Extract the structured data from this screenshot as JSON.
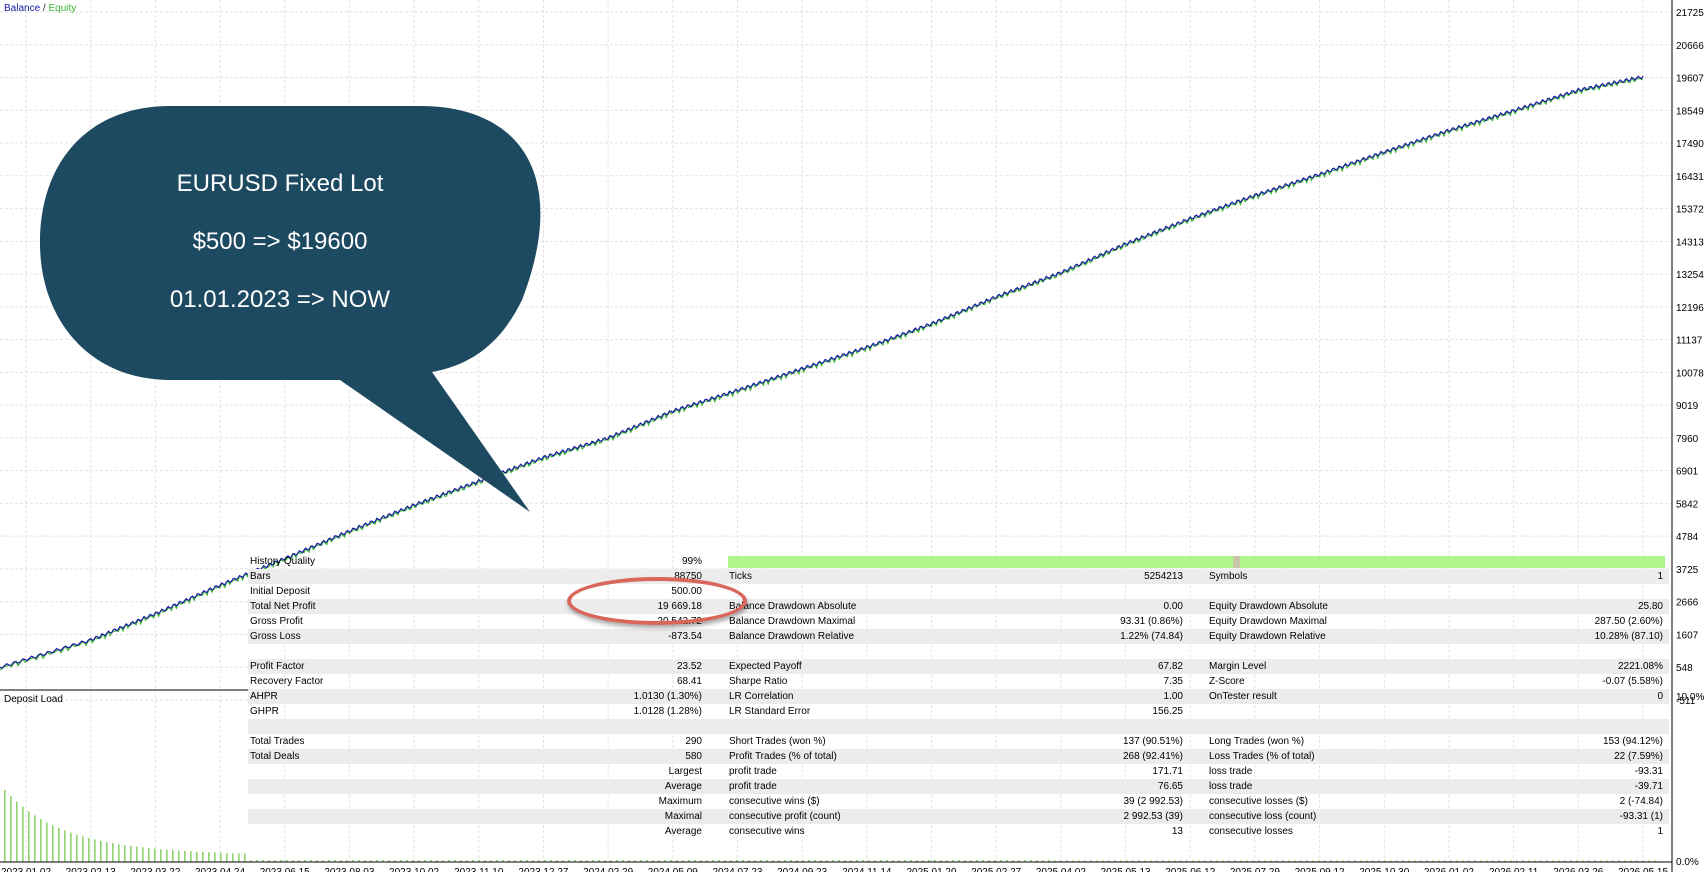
{
  "legend": {
    "balance": "Balance",
    "separator": "/",
    "equity": "Equity"
  },
  "colors": {
    "balance": "#1a1aa8",
    "equity": "#3cb531",
    "bubble": "#1d4a61",
    "oval": "#d8665a",
    "quality_bar": "#aef58c",
    "deposit_load": "#8fd36a"
  },
  "callout": {
    "line1": "EURUSD Fixed Lot",
    "line2": "$500 => $19600",
    "line3": "01.01.2023 => NOW"
  },
  "deposit_load_label": "Deposit Load",
  "deposit_load_axis": [
    "10.0%",
    "0.0%"
  ],
  "chart_data": {
    "type": "line",
    "series": [
      {
        "name": "Balance",
        "color": "#1a1aa8"
      },
      {
        "name": "Equity",
        "color": "#3cb531"
      }
    ],
    "x": [
      "2023.01.02",
      "2023.02.13",
      "2023.03.22",
      "2023.04.24",
      "2023.06.15",
      "2023.08.03",
      "2023.10.02",
      "2023.11.10",
      "2023.12.27",
      "2024.02.29",
      "2024.05.09",
      "2024.07.23",
      "2024.09.23",
      "2024.11.14",
      "2025.01.20",
      "2025.02.27",
      "2025.04.02",
      "2025.05.13",
      "2025.06.12",
      "2025.07.29",
      "2025.09.12",
      "2025.10.30",
      "2026.01.02",
      "2026.02.11",
      "2026.03.26",
      "2026.05.15"
    ],
    "balance_values": [
      548,
      1430,
      2280,
      3200,
      4060,
      4950,
      5790,
      6560,
      7330,
      7960,
      8830,
      9500,
      10200,
      10890,
      11650,
      12520,
      13300,
      14230,
      15050,
      15800,
      16480,
      17200,
      17900,
      18540,
      19200,
      19630
    ],
    "y_ticks": [
      21725,
      20666,
      19607,
      18549,
      17490,
      16431,
      15372,
      14313,
      13254,
      12196,
      11137,
      10078,
      9019,
      7960,
      6901,
      5842,
      4784,
      3725,
      2666,
      1607,
      548,
      -511
    ],
    "ylim": [
      -511,
      21725
    ],
    "grid": true
  },
  "report": {
    "history_quality": {
      "label": "History Quality",
      "value": "99%",
      "fill": 0.99
    },
    "rows": [
      {
        "shade": true,
        "l1": "Bars",
        "v1": "88750",
        "l2": "Ticks",
        "v2": "5254213",
        "l3": "Symbols",
        "v3": "1"
      },
      {
        "shade": false,
        "l1": "Initial Deposit",
        "v1": "500.00",
        "l2": "",
        "v2": "",
        "l3": "",
        "v3": ""
      },
      {
        "shade": true,
        "l1": "Total Net Profit",
        "v1": "19 669.18",
        "l2": "Balance Drawdown Absolute",
        "v2": "0.00",
        "l3": "Equity Drawdown Absolute",
        "v3": "25.80"
      },
      {
        "shade": false,
        "l1": "Gross Profit",
        "v1": "20 542.72",
        "l2": "Balance Drawdown Maximal",
        "v2": "93.31 (0.86%)",
        "l3": "Equity Drawdown Maximal",
        "v3": "287.50 (2.60%)"
      },
      {
        "shade": true,
        "l1": "Gross Loss",
        "v1": "-873.54",
        "l2": "Balance Drawdown Relative",
        "v2": "1.22% (74.84)",
        "l3": "Equity Drawdown Relative",
        "v3": "10.28% (87.10)"
      },
      {
        "shade": false,
        "l1": "",
        "v1": "",
        "l2": "",
        "v2": "",
        "l3": "",
        "v3": ""
      },
      {
        "shade": true,
        "l1": "Profit Factor",
        "v1": "23.52",
        "l2": "Expected Payoff",
        "v2": "67.82",
        "l3": "Margin Level",
        "v3": "2221.08%"
      },
      {
        "shade": false,
        "l1": "Recovery Factor",
        "v1": "68.41",
        "l2": "Sharpe Ratio",
        "v2": "7.35",
        "l3": "Z-Score",
        "v3": "-0.07 (5.58%)"
      },
      {
        "shade": true,
        "l1": "AHPR",
        "v1": "1.0130 (1.30%)",
        "l2": "LR Correlation",
        "v2": "1.00",
        "l3": "OnTester result",
        "v3": "0"
      },
      {
        "shade": false,
        "l1": "GHPR",
        "v1": "1.0128 (1.28%)",
        "l2": "LR Standard Error",
        "v2": "156.25",
        "l3": "",
        "v3": ""
      },
      {
        "shade": true,
        "l1": "",
        "v1": "",
        "l2": "",
        "v2": "",
        "l3": "",
        "v3": ""
      },
      {
        "shade": false,
        "l1": "Total Trades",
        "v1": "290",
        "l2": "Short Trades (won %)",
        "v2": "137 (90.51%)",
        "l3": "Long Trades (won %)",
        "v3": "153 (94.12%)"
      },
      {
        "shade": true,
        "l1": "Total Deals",
        "v1": "580",
        "l2": "Profit Trades (% of total)",
        "v2": "268 (92.41%)",
        "l3": "Loss Trades (% of total)",
        "v3": "22 (7.59%)"
      },
      {
        "shade": false,
        "l1": "",
        "v1": "Largest",
        "l2": "profit trade",
        "v2": "171.71",
        "l3": "loss trade",
        "v3": "-93.31"
      },
      {
        "shade": true,
        "l1": "",
        "v1": "Average",
        "l2": "profit trade",
        "v2": "76.65",
        "l3": "loss trade",
        "v3": "-39.71"
      },
      {
        "shade": false,
        "l1": "",
        "v1": "Maximum",
        "l2": "consecutive wins ($)",
        "v2": "39 (2 992.53)",
        "l3": "consecutive losses ($)",
        "v3": "2 (-74.84)"
      },
      {
        "shade": true,
        "l1": "",
        "v1": "Maximal",
        "l2": "consecutive profit (count)",
        "v2": "2 992.53 (39)",
        "l3": "consecutive loss (count)",
        "v3": "-93.31 (1)"
      },
      {
        "shade": false,
        "l1": "",
        "v1": "Average",
        "l2": "consecutive wins",
        "v2": "13",
        "l3": "consecutive losses",
        "v3": "1"
      }
    ]
  }
}
